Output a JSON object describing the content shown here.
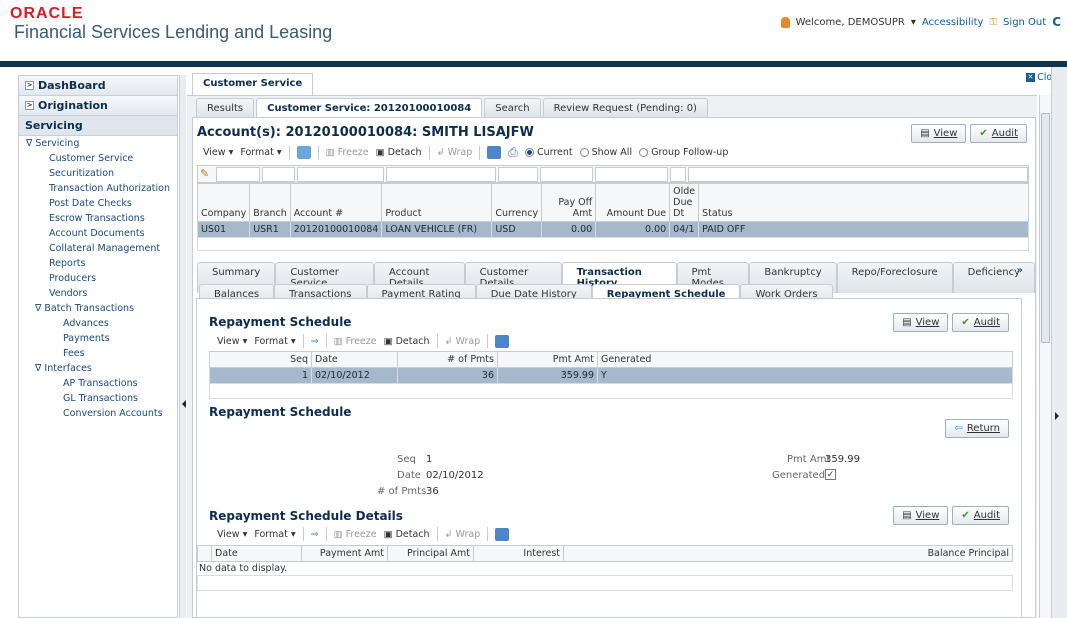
{
  "header": {
    "brand": "ORACLE",
    "product": "Financial Services Lending and Leasing",
    "welcome": "Welcome, DEMOSUPR",
    "accessibility": "Accessibility",
    "sign_out": "Sign Out"
  },
  "sidebar": {
    "dashboard": "DashBoard",
    "origination": "Origination",
    "servicing": "Servicing",
    "servicing_group": "Servicing",
    "items": [
      "Customer Service",
      "Securitization",
      "Transaction Authorization",
      "Post Date Checks",
      "Escrow Transactions",
      "Account Documents",
      "Collateral Management",
      "Reports",
      "Producers",
      "Vendors"
    ],
    "batch_group": "Batch Transactions",
    "batch_items": [
      "Advances",
      "Payments",
      "Fees"
    ],
    "interfaces_group": "Interfaces",
    "interface_items": [
      "AP Transactions",
      "GL Transactions",
      "Conversion Accounts"
    ]
  },
  "main": {
    "top_tab": "Customer Service",
    "close": "Close",
    "tabs": [
      "Results",
      "Customer Service: 20120100010084",
      "Search",
      "Review Request (Pending: 0)"
    ],
    "account_title": "Account(s): 20120100010084: SMITH LISAJFW",
    "view_btn": "View",
    "audit_btn": "Audit",
    "toolbar": {
      "view": "View",
      "format": "Format",
      "freeze": "Freeze",
      "detach": "Detach",
      "wrap": "Wrap"
    },
    "radios": {
      "current": "Current",
      "show_all": "Show All",
      "group_follow": "Group Follow-up"
    },
    "accounts_table": {
      "headers": [
        "Company",
        "Branch",
        "Account #",
        "Product",
        "Currency",
        "Pay Off Amt",
        "Amount Due",
        "Olde Due Dt",
        "Status"
      ],
      "rows": [
        [
          "US01",
          "USR1",
          "20120100010084",
          "LOAN VEHICLE (FR)",
          "USD",
          "0.00",
          "0.00",
          "04/1",
          "PAID OFF"
        ]
      ]
    },
    "detail_tabs": [
      "Summary",
      "Customer Service",
      "Account Details",
      "Customer Details",
      "Transaction History",
      "Pmt Modes",
      "Bankruptcy",
      "Repo/Foreclosure",
      "Deficiency"
    ],
    "more": "»",
    "history_tabs": [
      "Balances",
      "Transactions",
      "Payment Rating",
      "Due Date History",
      "Repayment Schedule",
      "Work Orders"
    ],
    "rs_title": "Repayment Schedule",
    "rs_table": {
      "headers": [
        "Seq",
        "Date",
        "# of Pmts",
        "Pmt Amt",
        "Generated"
      ],
      "rows": [
        [
          "1",
          "02/10/2012",
          "36",
          "359.99",
          "Y"
        ]
      ]
    },
    "rs_detail_title": "Repayment Schedule",
    "return_btn": "Return",
    "fields": {
      "seq_label": "Seq",
      "seq": "1",
      "date_label": "Date",
      "date": "02/10/2012",
      "pmts_label": "# of Pmts",
      "pmts": "36",
      "pmtamt_label": "Pmt Amt",
      "pmtamt": "359.99",
      "generated_label": "Generated",
      "generated": "✓"
    },
    "rsd_title": "Repayment Schedule Details",
    "rsd_table": {
      "headers": [
        "Date",
        "Payment Amt",
        "Principal Amt",
        "Interest",
        "Balance Principal"
      ],
      "empty": "No data to display."
    }
  }
}
